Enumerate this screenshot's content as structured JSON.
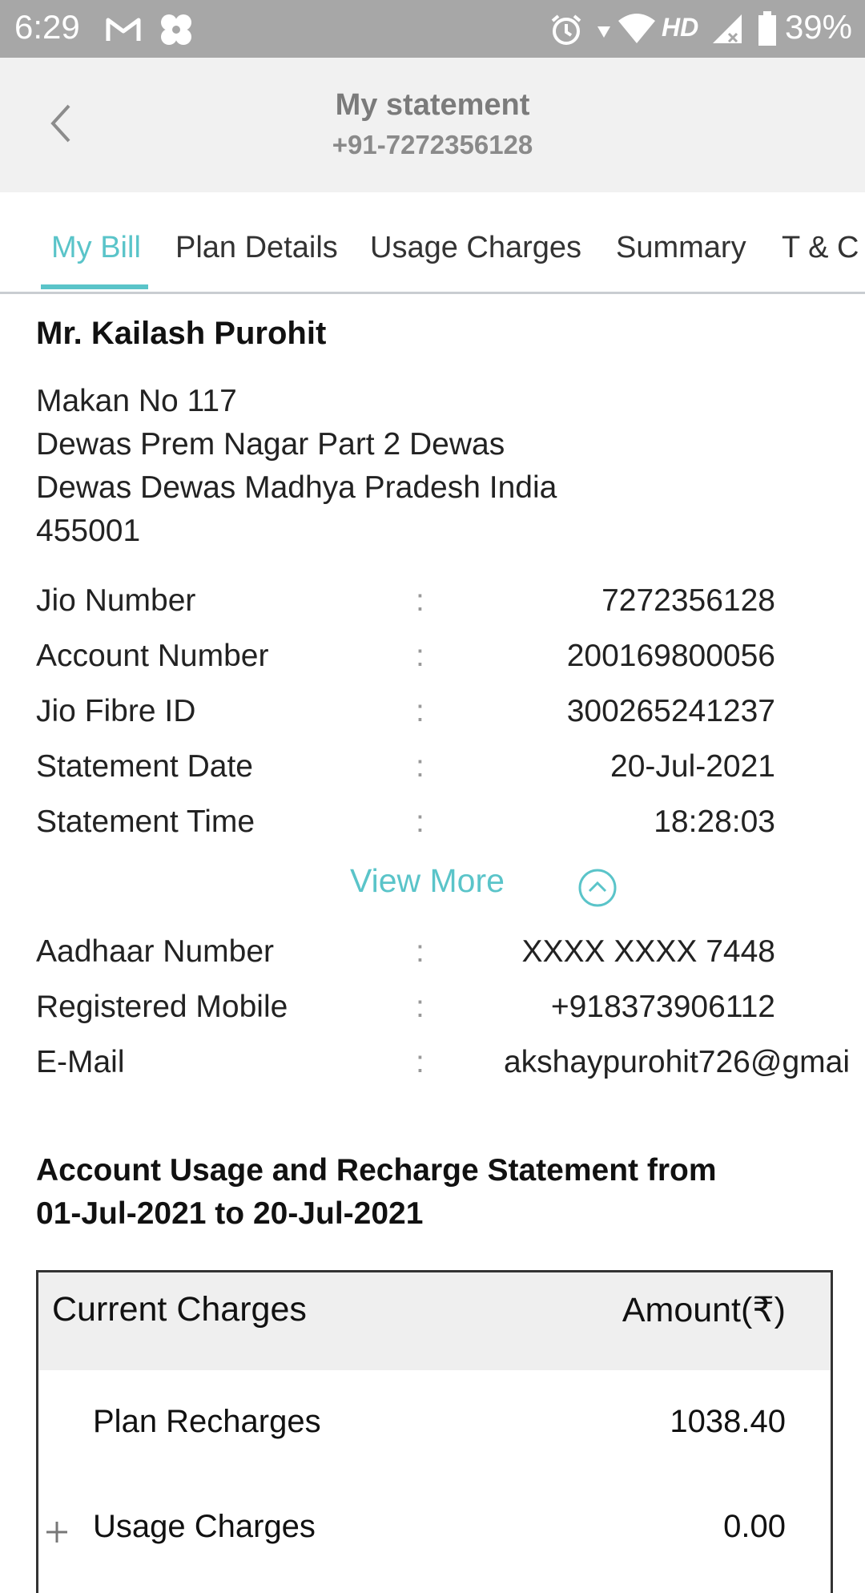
{
  "status_bar": {
    "time": "6:29",
    "battery": "39%",
    "network": "HD"
  },
  "header": {
    "title": "My statement",
    "subtitle": "+91-7272356128"
  },
  "tabs": [
    {
      "label": "My Bill",
      "active": true
    },
    {
      "label": "Plan Details",
      "active": false
    },
    {
      "label": "Usage Charges",
      "active": false
    },
    {
      "label": "Summary",
      "active": false
    },
    {
      "label": "T & C",
      "active": false
    }
  ],
  "customer": {
    "name": "Mr. Kailash Purohit",
    "address_lines": [
      "Makan No 117",
      "Dewas Prem Nagar Part 2 Dewas",
      "Dewas Dewas Madhya Pradesh India",
      "455001"
    ]
  },
  "details": [
    {
      "label": "Jio Number",
      "value": "7272356128"
    },
    {
      "label": "Account Number",
      "value": "200169800056"
    },
    {
      "label": "Jio Fibre ID",
      "value": "300265241237"
    },
    {
      "label": "Statement Date",
      "value": "20-Jul-2021"
    },
    {
      "label": "Statement Time",
      "value": "18:28:03"
    }
  ],
  "colon": ":",
  "view_more": "View More",
  "extra_details": [
    {
      "label": "Aadhaar Number",
      "value": "XXXX XXXX 7448"
    },
    {
      "label": "Registered Mobile",
      "value": "+918373906112"
    },
    {
      "label": "E-Mail",
      "value": "akshaypurohit726@gmai"
    }
  ],
  "statement": {
    "title_line1": "Account Usage and Recharge Statement from",
    "title_line2": "01-Jul-2021 to 20-Jul-2021"
  },
  "charges": {
    "header_left": "Current Charges",
    "header_right": "Amount(₹)",
    "rows": [
      {
        "label": "Plan Recharges",
        "value": "1038.40"
      },
      {
        "label": "Usage Charges",
        "value": "0.00"
      }
    ]
  },
  "colors": {
    "accent": "#5ac4c9",
    "status_bar": "#a7a7a7",
    "header_bg": "#f1f1f1"
  }
}
